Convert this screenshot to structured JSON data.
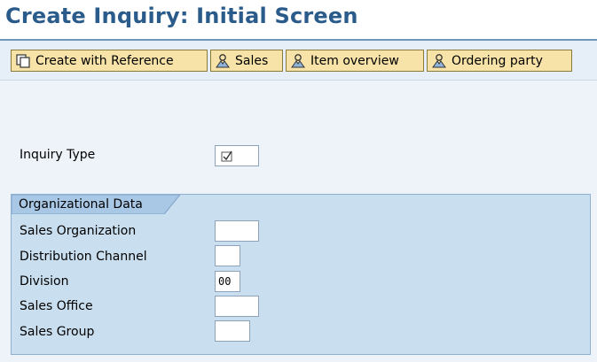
{
  "screen": {
    "title": "Create Inquiry: Initial Screen"
  },
  "toolbar": {
    "buttons": [
      {
        "label": "Create with Reference",
        "icon": "copy-document-icon"
      },
      {
        "label": "Sales",
        "icon": "person-icon"
      },
      {
        "label": "Item overview",
        "icon": "person-icon"
      },
      {
        "label": "Ordering party",
        "icon": "person-icon"
      }
    ]
  },
  "form": {
    "inquiry_type": {
      "label": "Inquiry Type",
      "value": "",
      "icon": "search-help-check-icon"
    }
  },
  "org_data": {
    "title": "Organizational Data",
    "fields": [
      {
        "label": "Sales Organization",
        "value": ""
      },
      {
        "label": "Distribution Channel",
        "value": ""
      },
      {
        "label": "Division",
        "value": "00"
      },
      {
        "label": "Sales Office",
        "value": ""
      },
      {
        "label": "Sales Group",
        "value": ""
      }
    ]
  },
  "colors": {
    "title": "#2a5b8a",
    "toolbar_button": "#f7e3a8",
    "content_bg": "#edf3f9",
    "group_bg": "#c9deef"
  }
}
